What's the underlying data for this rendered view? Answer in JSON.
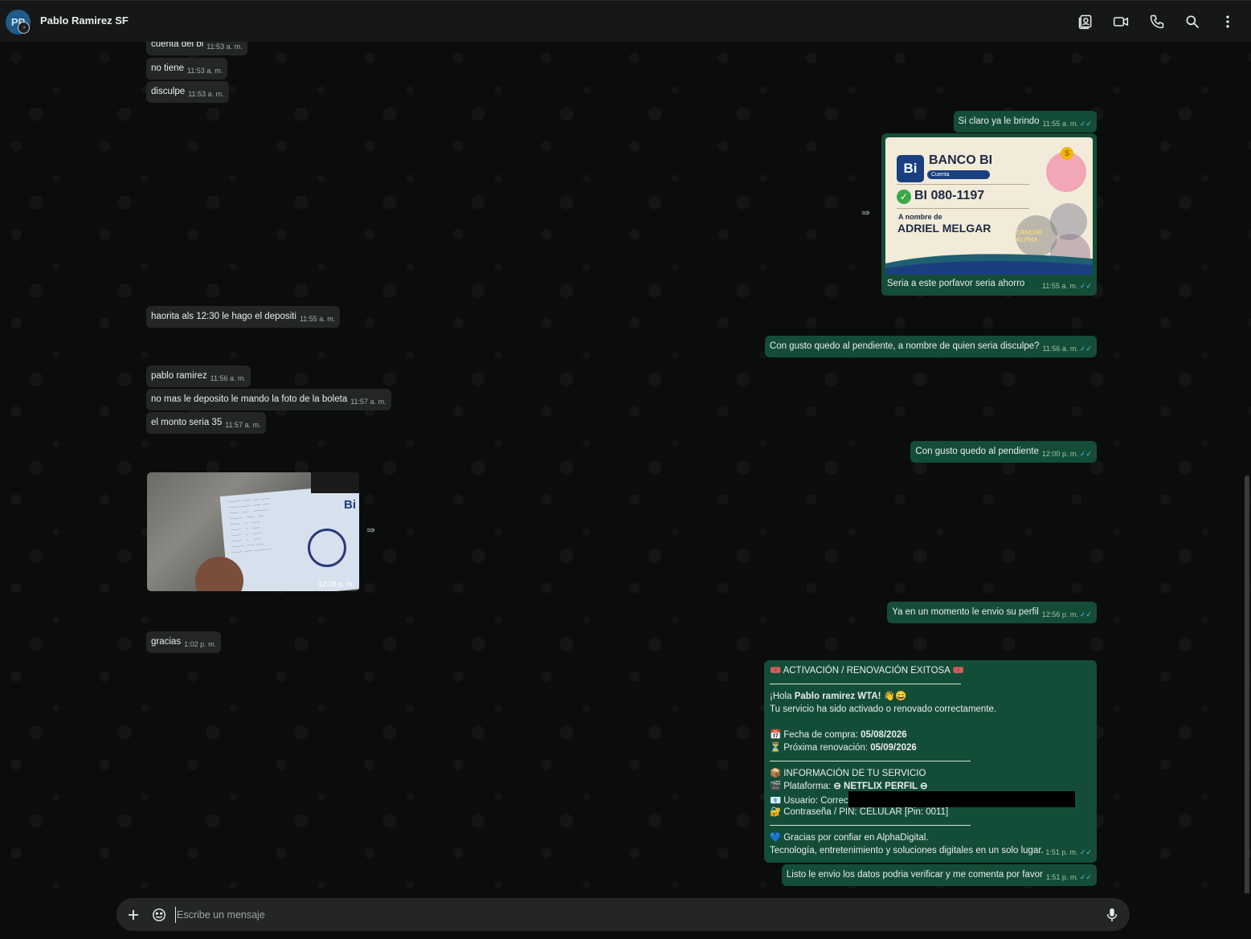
{
  "header": {
    "avatar_initials": "PP",
    "contact_name": "Pablo Ramirez SF",
    "icons": [
      "contact-card-icon",
      "video-call-icon",
      "voice-call-icon",
      "search-icon",
      "more-options-icon"
    ]
  },
  "messages": [
    {
      "dir": "in",
      "text": "cuenta del bi",
      "time": "11:53 a. m."
    },
    {
      "dir": "in",
      "text": "no tiene",
      "time": "11:53 a. m."
    },
    {
      "dir": "in",
      "text": "disculpe",
      "time": "11:53 a. m."
    },
    {
      "dir": "out",
      "text": "Si claro ya le brindo",
      "time": "11:55 a. m."
    },
    {
      "dir": "out",
      "type": "image",
      "caption": "Seria a este porfavor seria ahorro",
      "time": "11:55 a. m.",
      "image": {
        "bank_logo": "Bi",
        "bank_name": "BANCO BI",
        "account_tag": "Cuenta",
        "account_number": "BI  080-1197",
        "holder_label": "A nombre de",
        "holder_name": "ADRIEL MELGAR",
        "watermark": "CANCHE ALPHA"
      }
    },
    {
      "dir": "in",
      "text": "haorita  als 12:30 le hago el depositi",
      "time": "11:55 a. m."
    },
    {
      "dir": "out",
      "text": "Con gusto quedo al pendiente, a nombre de quien seria disculpe?",
      "time": "11:56 a. m."
    },
    {
      "dir": "in",
      "text": "pablo ramirez",
      "time": "11:56 a. m."
    },
    {
      "dir": "in",
      "text": "no mas le deposito le mando la foto de la boleta",
      "time": "11:57 a. m."
    },
    {
      "dir": "in",
      "text": "el monto seria 35",
      "time": "11:57 a. m."
    },
    {
      "dir": "out",
      "text": "Con gusto quedo al pendiente",
      "time": "12:00 p. m."
    },
    {
      "dir": "in",
      "type": "image",
      "time": "12:38 p. m.",
      "image": {
        "logo": "Bi"
      }
    },
    {
      "dir": "out",
      "text": "Ya en un momento le envio su perfil",
      "time": "12:56 p. m."
    },
    {
      "dir": "in",
      "text": "gracias",
      "time": "1:02 p. m."
    },
    {
      "dir": "out",
      "type": "long",
      "time": "1:51 p. m.",
      "lines": {
        "title_icon": "🎟️",
        "title": "ACTIVACIÓN / RENOVACIÓN EXITOSA",
        "greeting_prefix": "¡Hola ",
        "greeting_name": "Pablo ramirez WTA!",
        "greeting_emoji": "👋😄",
        "activated": "Tu servicio ha sido activado o renovado correctamente.",
        "purchase_icon": "📅",
        "purchase_label": "Fecha de compra: ",
        "purchase_date": "05/08/2026",
        "renewal_icon": "⏳",
        "renewal_label": "Próxima renovación: ",
        "renewal_date": "05/09/2026",
        "info_icon": "📦",
        "info_title": "INFORMACIÓN DE TU SERVICIO",
        "platform_icon": "🎬",
        "platform_label": "Plataforma: ",
        "platform_value": "⊖ NETFLIX PERFIL ⊖",
        "user_icon": "📧",
        "user_label": "Usuario: Correc",
        "pin_icon": "🔐",
        "pin_text": "Contraseña / PIN: CELULAR [Pin: 0011]",
        "thanks_icon": "💙",
        "thanks": "Gracias por confiar en AlphaDigital.",
        "tagline": "Tecnología, entretenimiento y soluciones digitales en un solo lugar."
      }
    },
    {
      "dir": "out",
      "text": "Listo le envio los datos podria verificar y me comenta por favor",
      "time": "1:51 p. m."
    }
  ],
  "composer": {
    "placeholder": "Escribe un mensaje"
  },
  "colors": {
    "background": "#0b0c0c",
    "incoming_bubble": "#242626",
    "outgoing_bubble": "#144d37",
    "read_tick": "#53bdeb"
  }
}
